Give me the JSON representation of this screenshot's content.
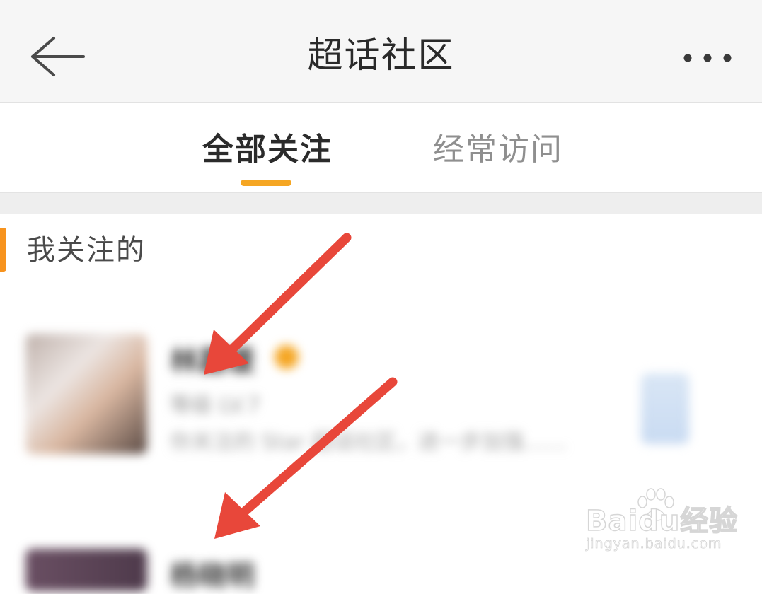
{
  "header": {
    "title": "超话社区",
    "back_icon": "arrow-left-icon",
    "more_icon": "more-horizontal-icon"
  },
  "tabs": [
    {
      "label": "全部关注",
      "active": true
    },
    {
      "label": "经常访问",
      "active": false
    }
  ],
  "section": {
    "title": "我关注的"
  },
  "list": {
    "items": [
      {
        "name": "林嘉瑗",
        "meta": "等级 LV.7",
        "desc": "你关注的 Star 超话社区，进一步加强……"
      },
      {
        "name": "杨晓明"
      }
    ]
  },
  "watermark": {
    "brand": "Baidu经验",
    "url": "jingyan.baidu.com"
  },
  "colors": {
    "accent": "#f5a623",
    "section_marker": "#f7931e",
    "arrow": "#e8473a",
    "header_bg": "#f6f6f6"
  }
}
